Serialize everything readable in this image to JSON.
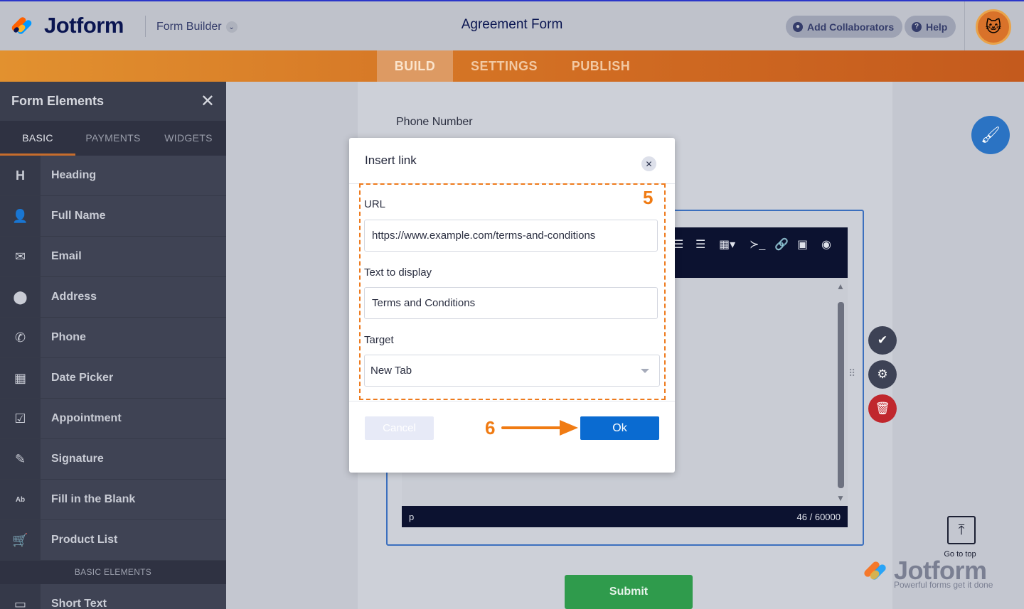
{
  "header": {
    "brand": "Jotform",
    "mode_label": "Form Builder",
    "form_title": "Agreement Form",
    "add_collaborators": "Add Collaborators",
    "help": "Help"
  },
  "tabs": [
    "BUILD",
    "SETTINGS",
    "PUBLISH"
  ],
  "active_tab": "BUILD",
  "left_panel": {
    "title": "Form Elements",
    "tabs": [
      "BASIC",
      "PAYMENTS",
      "WIDGETS"
    ],
    "items": [
      {
        "label": "Heading",
        "icon": "heading-icon",
        "glyph": "H"
      },
      {
        "label": "Full Name",
        "icon": "person-icon",
        "glyph": "👤"
      },
      {
        "label": "Email",
        "icon": "envelope-icon",
        "glyph": "✉"
      },
      {
        "label": "Address",
        "icon": "location-pin-icon",
        "glyph": "⬤"
      },
      {
        "label": "Phone",
        "icon": "phone-icon",
        "glyph": "✆"
      },
      {
        "label": "Date Picker",
        "icon": "calendar-icon",
        "glyph": "▦"
      },
      {
        "label": "Appointment",
        "icon": "calendar-check-icon",
        "glyph": "☑"
      },
      {
        "label": "Signature",
        "icon": "pen-icon",
        "glyph": "✎"
      },
      {
        "label": "Fill in the Blank",
        "icon": "fill-blank-icon",
        "glyph": "Ab"
      },
      {
        "label": "Product List",
        "icon": "cart-icon",
        "glyph": "🛒"
      }
    ],
    "section_label": "BASIC ELEMENTS",
    "short_text": "Short Text"
  },
  "form": {
    "phone_label": "Phone Number",
    "editor_status_tag": "p",
    "editor_char_count": "46 / 60000",
    "submit_label": "Submit"
  },
  "go_to_top": "Go to top",
  "watermark": {
    "brand": "Jotform",
    "tagline": "Powerful forms get it done"
  },
  "modal": {
    "title": "Insert link",
    "url_label": "URL",
    "url_value": "https://www.example.com/terms-and-conditions",
    "text_label": "Text to display",
    "text_value": "Terms and Conditions",
    "target_label": "Target",
    "target_value": "New Tab",
    "cancel_label": "Cancel",
    "ok_label": "Ok"
  },
  "annotations": {
    "step_5": "5",
    "step_6": "6"
  },
  "colors": {
    "accent_orange": "#ee7a1c",
    "ok_blue": "#0a6bd1",
    "submit_green": "#2f9b4c",
    "delete_red": "#c0272d"
  }
}
